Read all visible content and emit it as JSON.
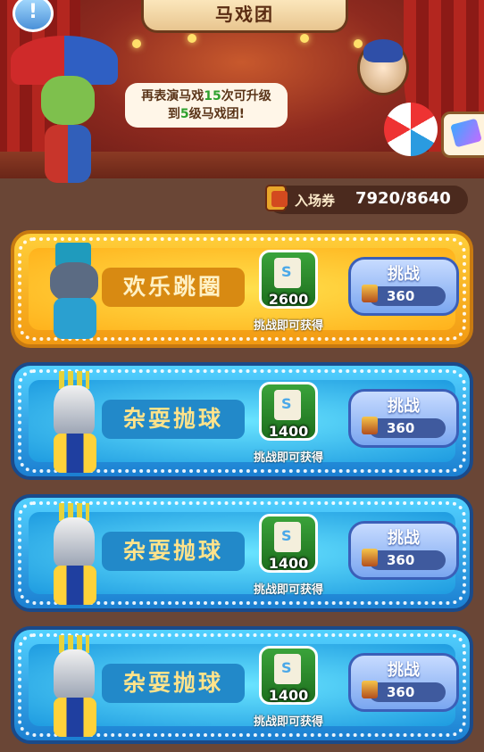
{
  "header": {
    "title": "马戏团",
    "info_icon": "info-icon"
  },
  "dialog": {
    "line1_prefix": "再表演马戏",
    "line1_highlight": "15",
    "line1_suffix": "次可升级",
    "line2_prefix": "到",
    "line2_highlight": "5",
    "line2_suffix": "级马戏团!"
  },
  "tickets": {
    "label": "入场券",
    "value": "7920/8640"
  },
  "acts": [
    {
      "name": "欢乐跳圈",
      "reward": "2600",
      "reward_caption": "挑战即可获得",
      "button_label": "挑战",
      "cost": "360",
      "theme": "gold"
    },
    {
      "name": "杂耍抛球",
      "reward": "1400",
      "reward_caption": "挑战即可获得",
      "button_label": "挑战",
      "cost": "360",
      "theme": "blue"
    },
    {
      "name": "杂耍抛球",
      "reward": "1400",
      "reward_caption": "挑战即可获得",
      "button_label": "挑战",
      "cost": "360",
      "theme": "blue"
    },
    {
      "name": "杂耍抛球",
      "reward": "1400",
      "reward_caption": "挑战即可获得",
      "button_label": "挑战",
      "cost": "360",
      "theme": "blue"
    }
  ],
  "colors": {
    "gold_card": "#f29a12",
    "blue_card": "#1b7fd1",
    "highlight_green": "#2ea12e"
  }
}
